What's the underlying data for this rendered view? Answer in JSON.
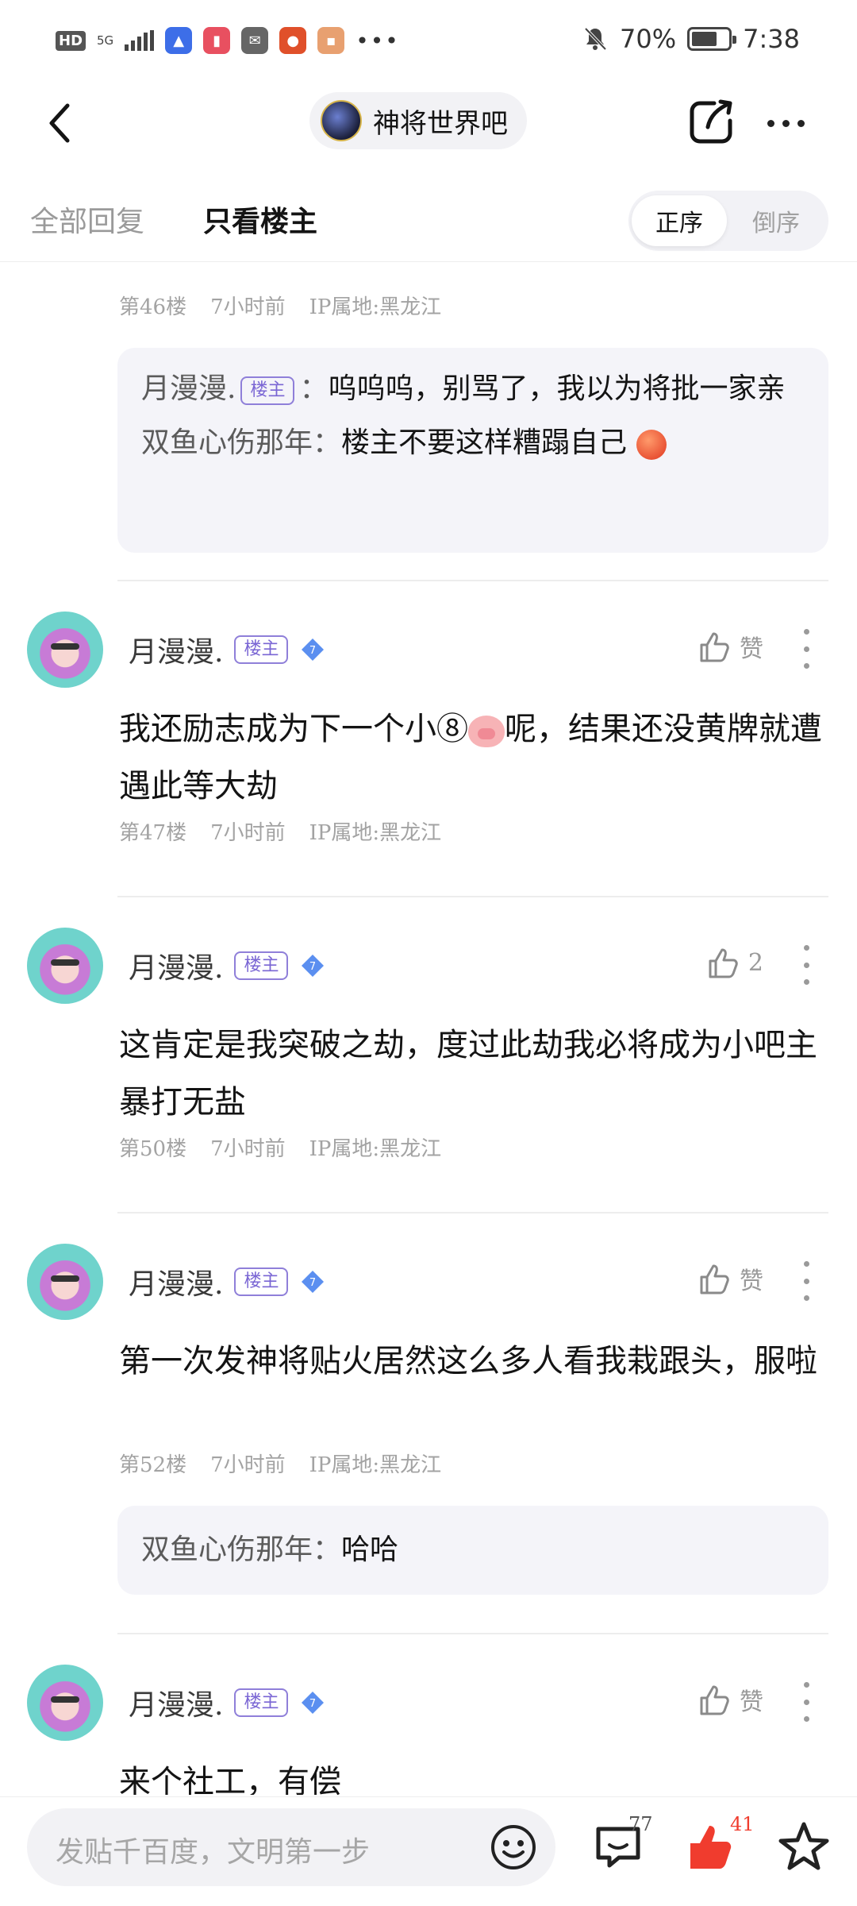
{
  "status_bar": {
    "network": "5G",
    "hd": "HD",
    "battery": "70%",
    "time": "7:38",
    "battery_level": 0.7
  },
  "nav": {
    "forum_name": "神将世界吧",
    "icons": [
      "back-icon",
      "share-icon",
      "more-icon"
    ]
  },
  "tabs": {
    "all": "全部回复",
    "owner_only": "只看楼主",
    "sort_asc": "正序",
    "sort_desc": "倒序"
  },
  "badge_label": "楼主",
  "top_post": {
    "floor": "第46楼",
    "time": "7小时前",
    "ip": "IP属地:黑龙江",
    "replies": [
      {
        "user": "月漫漫.",
        "is_owner": true,
        "text": "呜呜呜，别骂了，我以为将批一家亲"
      },
      {
        "user": "双鱼心伤那年",
        "is_owner": false,
        "text": "楼主不要这样糟蹋自己"
      }
    ]
  },
  "posts": [
    {
      "user": "月漫漫.",
      "like_label": "赞",
      "text": "我还励志成为下一个小⑧",
      "text_after_emoji": "呢，结果还没黄牌就遭遇此等大劫",
      "floor": "第47楼",
      "time": "7小时前",
      "ip": "IP属地:黑龙江"
    },
    {
      "user": "月漫漫.",
      "like_label": "2",
      "text": "这肯定是我突破之劫，度过此劫我必将成为小吧主暴打无盐",
      "floor": "第50楼",
      "time": "7小时前",
      "ip": "IP属地:黑龙江"
    },
    {
      "user": "月漫漫.",
      "like_label": "赞",
      "text": "第一次发神将贴火居然这么多人看我栽跟头，服啦",
      "floor": "第52楼",
      "time": "7小时前",
      "ip": "IP属地:黑龙江",
      "reply": {
        "user": "双鱼心伤那年",
        "text": "哈哈"
      }
    },
    {
      "user": "月漫漫.",
      "like_label": "赞",
      "text": "来个社工，有偿"
    }
  ],
  "bottom_bar": {
    "placeholder": "发贴千百度，文明第一步",
    "comment_count": "77",
    "like_count": "41"
  },
  "colors": {
    "badge": "#7a66d4",
    "diamond": "#5b8ff0",
    "like_active": "#f03c2e"
  }
}
